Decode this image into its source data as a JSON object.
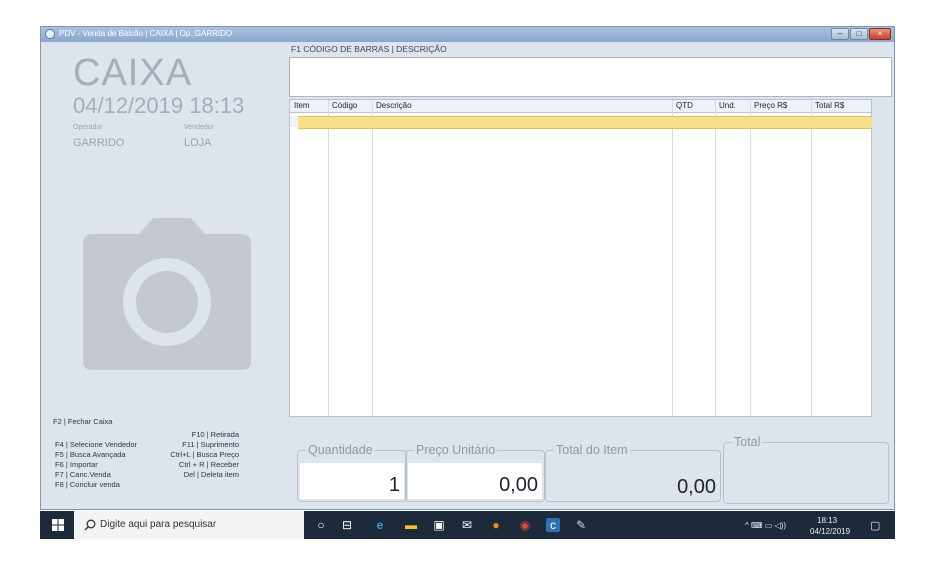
{
  "window": {
    "title": "PDV - Venda de Balcão | CAIXA | Op.:GARRIDO",
    "buttons": {
      "minimize": "–",
      "maximize": "□",
      "close": "×"
    }
  },
  "left_panel": {
    "title": "CAIXA",
    "datetime": "04/12/2019 18:13",
    "operator_label": "Operador",
    "operator_value": "GARRIDO",
    "seller_label": "Vendedor",
    "seller_value": "LOJA",
    "fechar_caixa": "F2 | Fechar Caixa",
    "shortcuts_left": [
      "F4 | Selecione Vendedor",
      "F5 | Busca Avançada",
      "F6 | Importar",
      "F7 | Canc.Venda",
      "F8 | Concluir venda"
    ],
    "shortcuts_right": [
      "F10 | Retirada",
      "F11 | Suprimento",
      "Ctrl+L | Busca Preço",
      "Ctrl + R | Receber",
      "Del | Deleta item"
    ]
  },
  "main": {
    "search_label": "F1 CÓDIGO DE BARRAS | DESCRIÇÃO",
    "search_value": "",
    "columns": [
      "Item",
      "Código",
      "Descrição",
      "QTD",
      "Und.",
      "Preço R$",
      "Total R$"
    ],
    "quantidade_label": "Quantidade",
    "quantidade_value": "1",
    "preco_label": "Preço Unitário",
    "preco_value": "0,00",
    "total_item_label": "Total do Item",
    "total_item_value": "0,00",
    "total_label": "Total",
    "total_value": ""
  },
  "taskbar": {
    "search_placeholder": "Digite aqui para pesquisar",
    "time": "18:13",
    "date": "04/12/2019",
    "icons": [
      "windows-icon",
      "search-icon",
      "cortana-icon",
      "task-view-icon",
      "edge-icon",
      "file-explorer-icon",
      "store-icon",
      "mail-icon",
      "firefox-icon",
      "chrome-icon",
      "app-icon",
      "paint-icon"
    ]
  },
  "colors": {
    "panel_bg": "#dde4ec",
    "selected_row": "#f6e08c",
    "taskbar": "#1d2a3a"
  }
}
